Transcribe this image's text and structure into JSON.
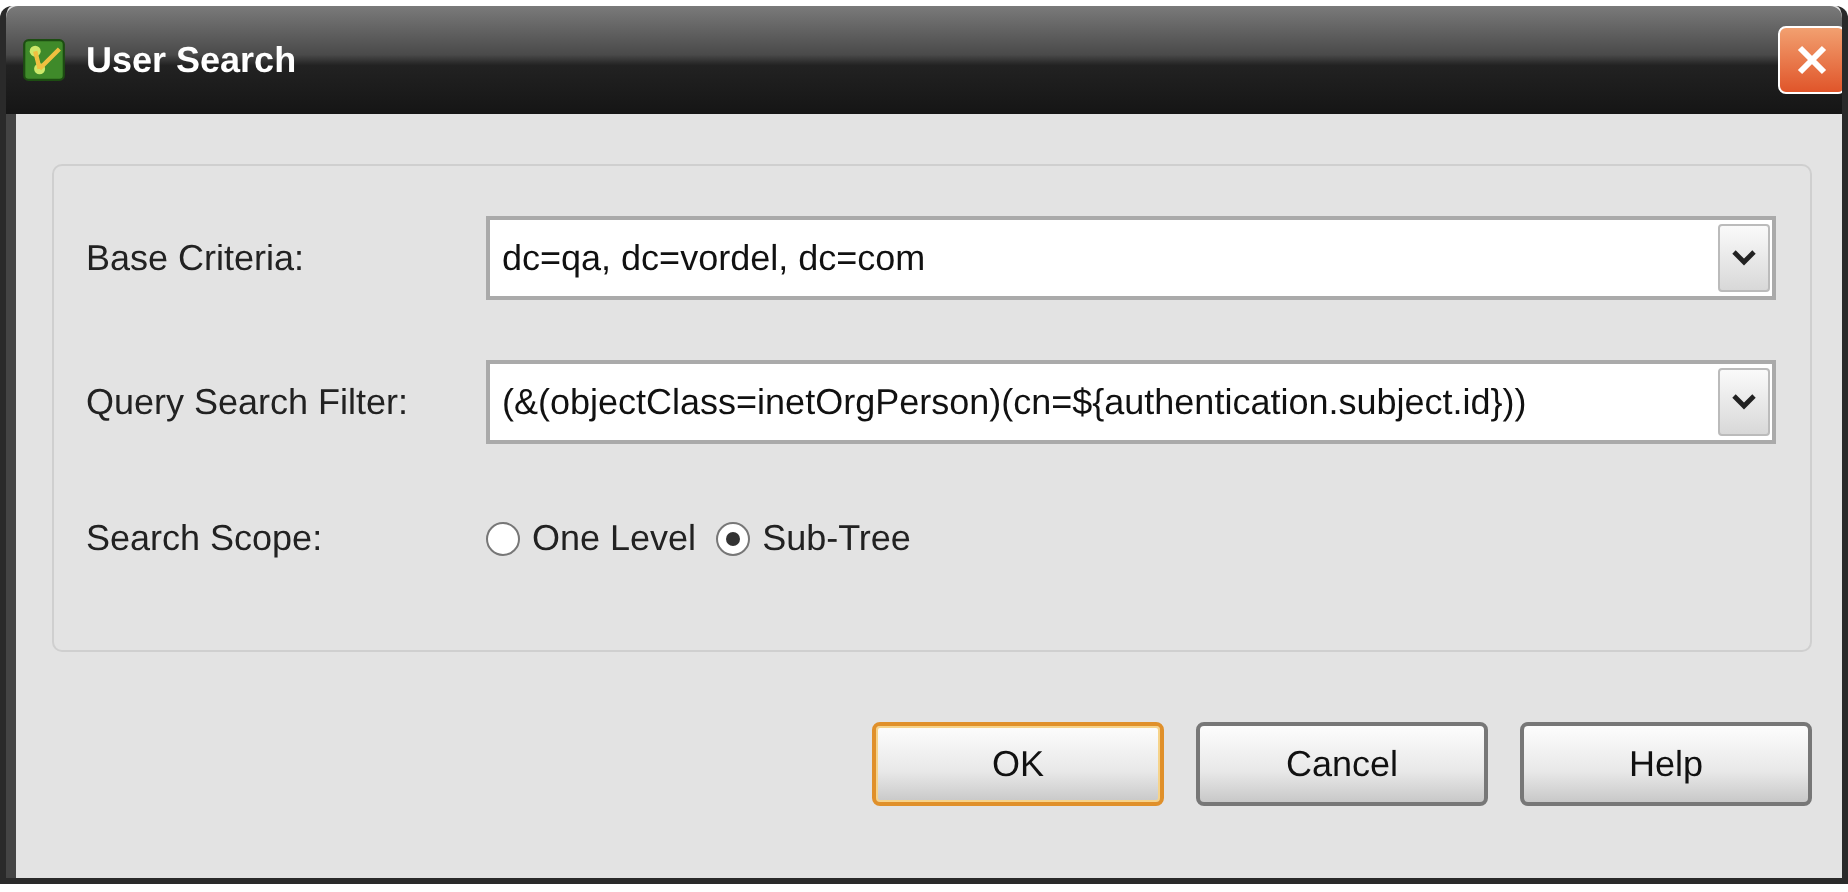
{
  "window": {
    "title": "User Search"
  },
  "fields": [
    {
      "label": "Base Criteria:",
      "value": "dc=qa, dc=vordel, dc=com"
    },
    {
      "label": "Query Search Filter:",
      "value": "(&(objectClass=inetOrgPerson)(cn=${authentication.subject.id}))"
    }
  ],
  "scope": {
    "label": "Search Scope:",
    "options": [
      {
        "label": "One Level",
        "selected": false
      },
      {
        "label": "Sub-Tree",
        "selected": true
      }
    ]
  },
  "buttons": [
    {
      "label": "OK",
      "default": true
    },
    {
      "label": "Cancel",
      "default": false
    },
    {
      "label": "Help",
      "default": false
    }
  ]
}
